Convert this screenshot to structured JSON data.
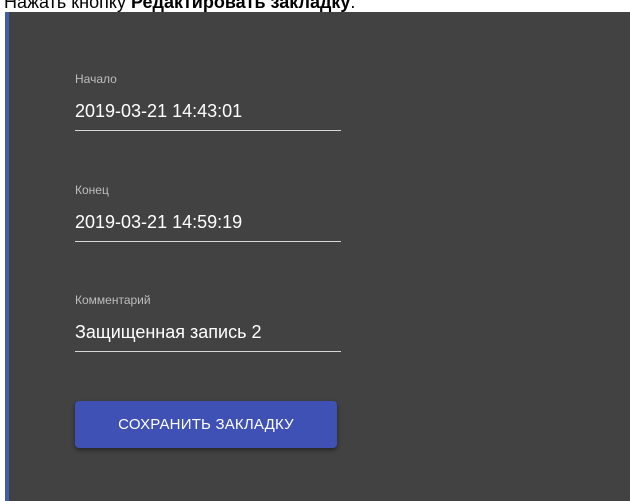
{
  "caption": {
    "prefix": "Нажать кнопку ",
    "bold": "Редактировать закладку",
    "suffix": "."
  },
  "form": {
    "start": {
      "label": "Начало",
      "value": "2019-03-21 14:43:01"
    },
    "end": {
      "label": "Конец",
      "value": "2019-03-21 14:59:19"
    },
    "comment": {
      "label": "Комментарий",
      "value": "Защищенная запись 2"
    },
    "save_label": "СОХРАНИТЬ ЗАКЛАДКУ"
  },
  "colors": {
    "panel_background": "#424242",
    "panel_left_border": "#3f5fa8",
    "button_background": "#3f51b5",
    "label_text": "#bdbdbd",
    "value_text": "#ffffff"
  }
}
